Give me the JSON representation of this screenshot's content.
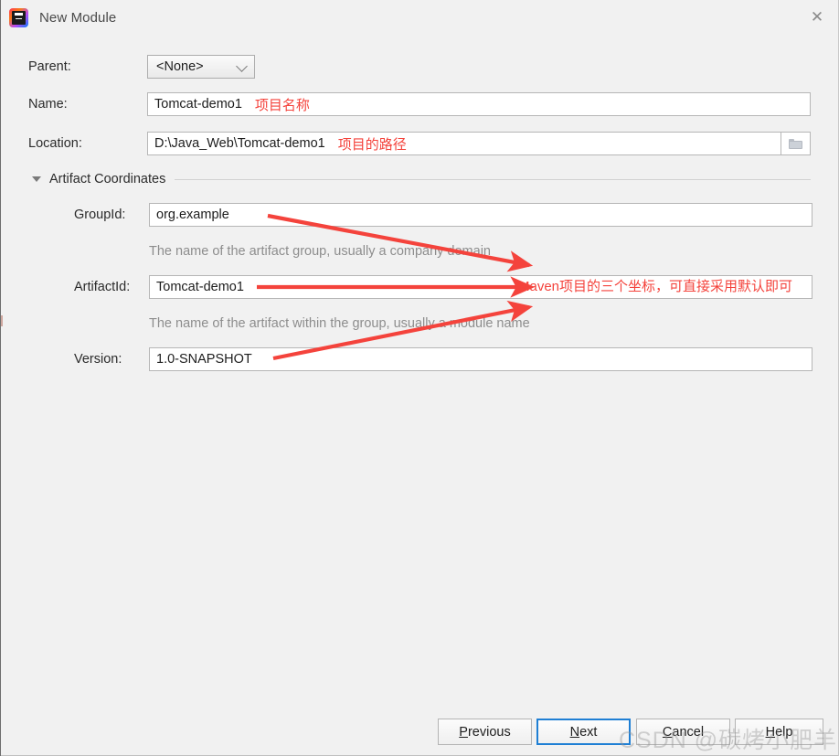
{
  "window": {
    "title": "New Module",
    "app_icon": "intellij-idea-logo",
    "close_icon": "close-icon"
  },
  "form": {
    "parent": {
      "label": "Parent:",
      "value": "<None>",
      "chevron_icon": "chevron-down-icon"
    },
    "name": {
      "label": "Name:",
      "value": "Tomcat-demo1",
      "annotation": "项目名称"
    },
    "location": {
      "label": "Location:",
      "value": "D:\\Java_Web\\Tomcat-demo1",
      "annotation": "项目的路径",
      "browse_icon": "folder-icon"
    },
    "section": {
      "title": "Artifact Coordinates",
      "toggle_icon": "triangle-down-icon"
    },
    "group_id": {
      "label": "GroupId:",
      "value": "org.example",
      "hint": "The name of the artifact group, usually a company domain"
    },
    "artifact_id": {
      "label": "ArtifactId:",
      "value": "Tomcat-demo1",
      "hint": "The name of the artifact within the group, usually a module name"
    },
    "version": {
      "label": "Version:",
      "value": "1.0-SNAPSHOT"
    }
  },
  "annotation": {
    "maven_note": "Maven项目的三个坐标，可直接采用默认即可"
  },
  "buttons": {
    "previous": {
      "prefix": "",
      "mnemonic": "P",
      "suffix": "revious"
    },
    "next": {
      "prefix": "",
      "mnemonic": "N",
      "suffix": "ext"
    },
    "cancel": {
      "prefix": "",
      "mnemonic": "C",
      "suffix": "ancel"
    },
    "help": {
      "prefix": "",
      "mnemonic": "H",
      "suffix": "elp"
    }
  },
  "watermark": {
    "text": "CSDN @碳烤小肥羊。"
  },
  "colors": {
    "accent": "#1f7fd4",
    "annotation_red": "#f4433c",
    "background": "#f1f1f1"
  }
}
